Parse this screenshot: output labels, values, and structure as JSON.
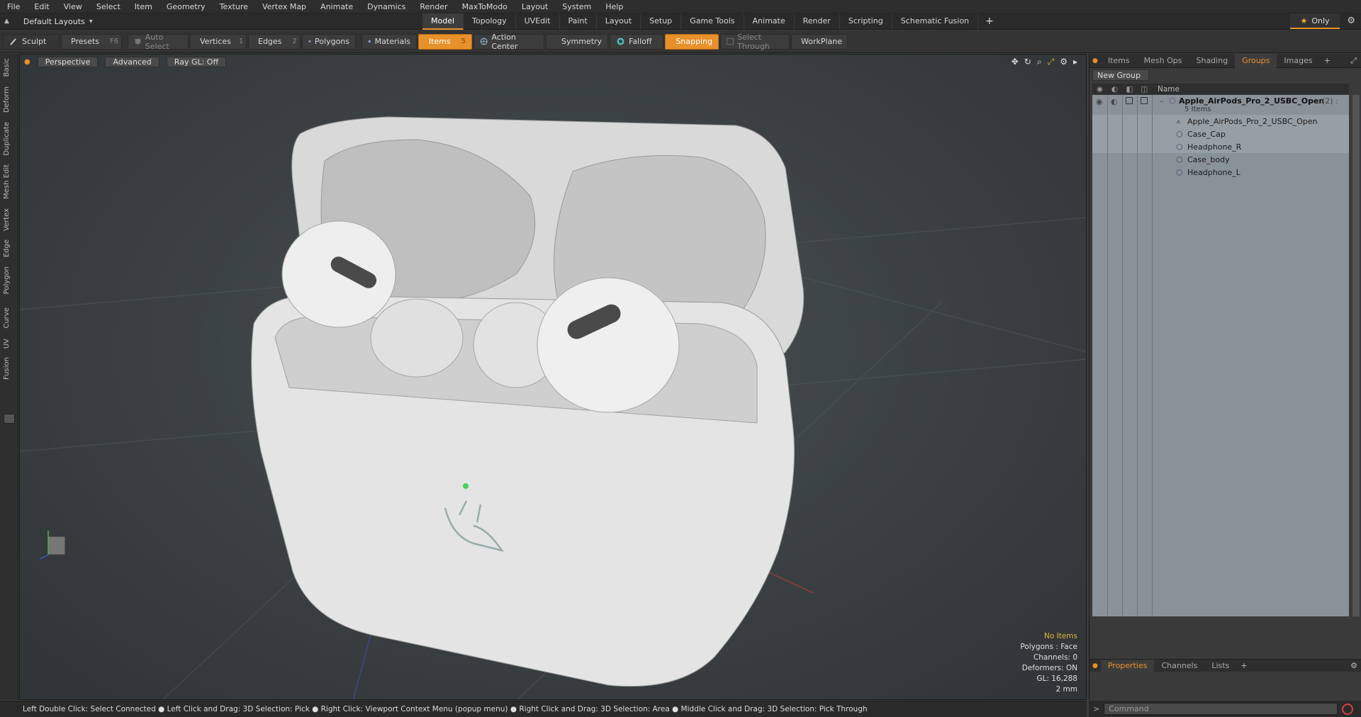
{
  "menu": [
    "File",
    "Edit",
    "View",
    "Select",
    "Item",
    "Geometry",
    "Texture",
    "Vertex Map",
    "Animate",
    "Dynamics",
    "Render",
    "MaxToModo",
    "Layout",
    "System",
    "Help"
  ],
  "layout": {
    "label": "Default Layouts"
  },
  "tabs": [
    "Model",
    "Topology",
    "UVEdit",
    "Paint",
    "Layout",
    "Setup",
    "Game Tools",
    "Animate",
    "Render",
    "Scripting",
    "Schematic Fusion"
  ],
  "active_tab": "Model",
  "only_label": "Only",
  "toolbar": {
    "sculpt": "Sculpt",
    "presets": "Presets",
    "presets_key": "F6",
    "auto_select": "Auto Select",
    "vertices": "Vertices",
    "vertices_count": "1",
    "edges": "Edges",
    "edges_count": "2",
    "polygons": "Polygons",
    "materials": "Materials",
    "items": "Items",
    "items_count": "5",
    "action_center": "Action Center",
    "symmetry": "Symmetry",
    "falloff": "Falloff",
    "snapping": "Snapping",
    "select_through": "Select Through",
    "workplane": "WorkPlane"
  },
  "left_tabs": [
    "Basic",
    "Deform",
    "Duplicate",
    "Mesh Edit",
    "Vertex",
    "Edge",
    "Polygon",
    "Curve",
    "UV",
    "Fusion"
  ],
  "viewport": {
    "view": "Perspective",
    "shading": "Advanced",
    "raygl": "Ray GL: Off",
    "info": {
      "selection": "No Items",
      "polygons": "Polygons : Face",
      "channels": "Channels: 0",
      "deformers": "Deformers: ON",
      "gl": "GL: 16,288",
      "scale": "2 mm"
    }
  },
  "panel": {
    "tabs": [
      "Items",
      "Mesh Ops",
      "Shading",
      "Groups",
      "Images"
    ],
    "active": "Groups",
    "new_group": "New Group",
    "name_col": "Name",
    "group": {
      "name": "Apple_AirPods_Pro_2_USBC_Open",
      "count": "(2) :",
      "sub": "5 Items"
    },
    "items": [
      "Apple_AirPods_Pro_2_USBC_Open",
      "Case_Cap",
      "Headphone_R",
      "Case_body",
      "Headphone_L"
    ],
    "bottom_tabs": [
      "Properties",
      "Channels",
      "Lists"
    ],
    "bottom_active": "Properties"
  },
  "status": "Left Double Click: Select Connected ● Left Click and Drag: 3D Selection: Pick ● Right Click: Viewport Context Menu (popup menu) ● Right Click and Drag: 3D Selection: Area ● Middle Click and Drag: 3D Selection: Pick Through",
  "command_placeholder": "Command",
  "colors": {
    "accent": "#e8912a",
    "tree_bg": "#8a9299"
  }
}
